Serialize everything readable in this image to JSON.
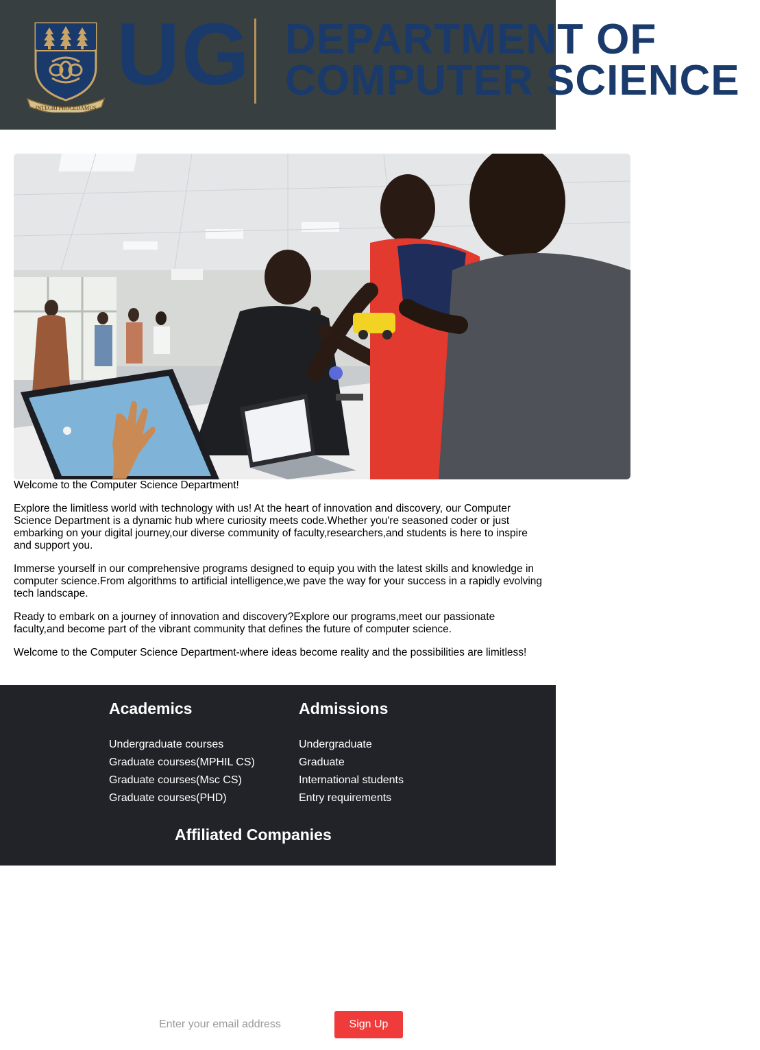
{
  "header": {
    "crest_motto": "INTEGRI PROCEDAMUS",
    "ug_mark": "UG",
    "title_line1": "DEPARTMENT OF",
    "title_line2": "COMPUTER SCIENCE",
    "brand_navy": "#1a3a6b",
    "brand_gold": "#b8925a",
    "bar_color": "#373f41"
  },
  "hero": {
    "icon": "hero-photo",
    "description_visible": false
  },
  "intro": {
    "greeting": "Welcome to the Computer Science Department!",
    "paragraphs": [
      "Explore the limitless world with technology with us! At the heart of innovation and discovery, our Computer Science Department is a dynamic hub where curiosity meets code.Whether you're seasoned coder or just embarking on your digital journey,our diverse community of faculty,researchers,and students is here to inspire and support you.",
      "Immerse yourself in our comprehensive programs designed to equip you with the latest skills and knowledge in computer science.From algorithms to artificial intelligence,we pave the way for your success in a rapidly evolving tech landscape.",
      "Ready to embark on a journey of innovation and discovery?Explore our programs,meet our passionate faculty,and become part of the vibrant community that defines the future of computer science.",
      "Welcome to the Computer Science Department-where ideas become reality and the possibilities are limitless!"
    ]
  },
  "footer": {
    "background": "#222328",
    "academics": {
      "heading": "Academics",
      "items": [
        "Undergraduate courses",
        "Graduate courses(MPHIL CS)",
        "Graduate courses(Msc CS)",
        "Graduate courses(PHD)"
      ]
    },
    "admissions": {
      "heading": "Admissions",
      "items": [
        "Undergraduate",
        "Graduate",
        "International students",
        "Entry requirements"
      ]
    },
    "affiliated_heading": "Affiliated Companies"
  },
  "signup": {
    "placeholder": "Enter your email address",
    "button_label": "Sign Up",
    "button_color": "#f03b3b"
  }
}
